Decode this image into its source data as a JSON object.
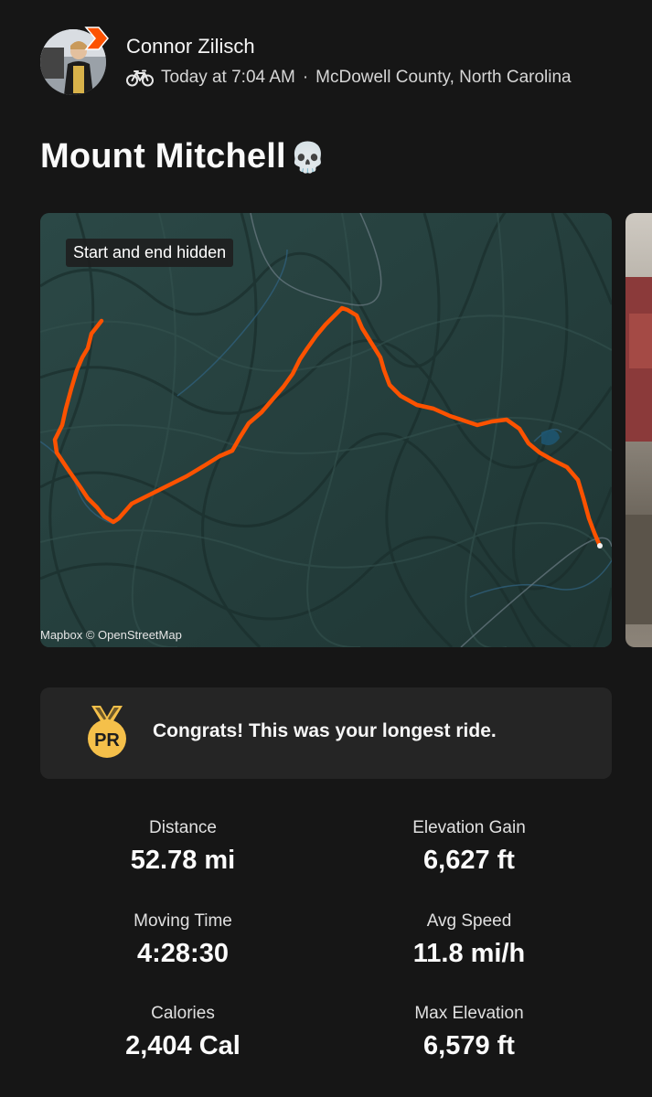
{
  "activity": {
    "athlete_name": "Connor Zilisch",
    "sport_icon": "bike-icon",
    "time": "Today at 7:04 AM",
    "separator": "·",
    "location": "McDowell County, North Carolina",
    "title": "Mount Mitchell",
    "title_emoji": "💀"
  },
  "map": {
    "privacy_label": "Start and end hidden",
    "credit": "Mapbox © OpenStreetMap",
    "route_color": "#fc5200",
    "background_color": "#26403e"
  },
  "achievement": {
    "medal_text": "PR",
    "message": "Congrats! This was your longest ride."
  },
  "stats": [
    {
      "label": "Distance",
      "value": "52.78 mi"
    },
    {
      "label": "Elevation Gain",
      "value": "6,627 ft"
    },
    {
      "label": "Moving Time",
      "value": "4:28:30"
    },
    {
      "label": "Avg Speed",
      "value": "11.8 mi/h"
    },
    {
      "label": "Calories",
      "value": "2,404 Cal"
    },
    {
      "label": "Max Elevation",
      "value": "6,579 ft"
    }
  ]
}
